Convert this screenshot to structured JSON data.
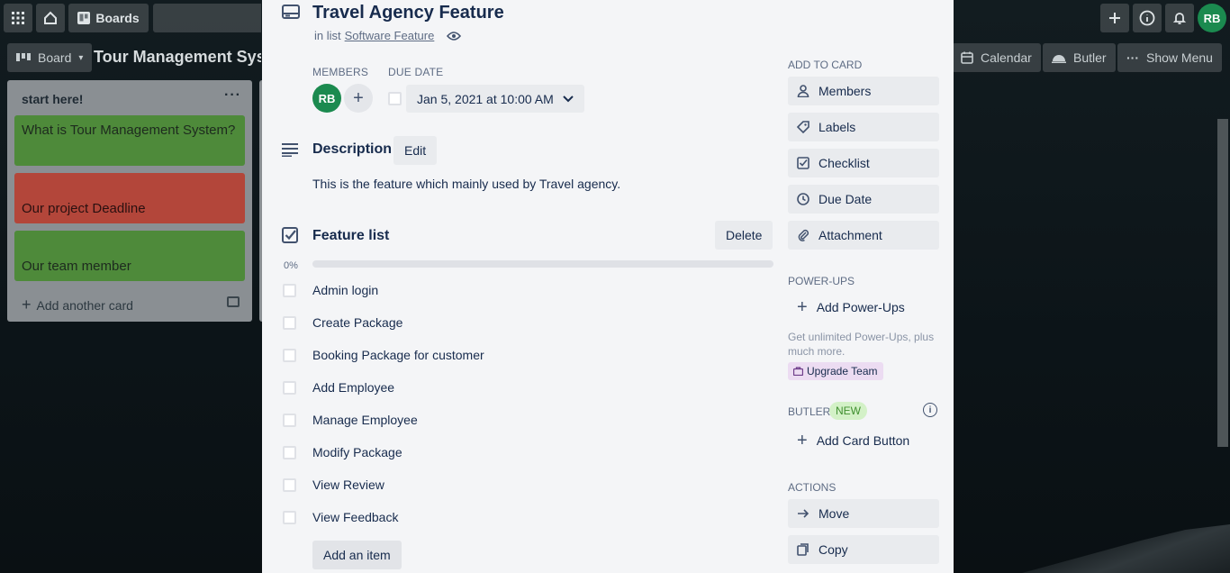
{
  "topbar": {
    "boards_label": "Boards",
    "user_initials": "RB"
  },
  "boardbar": {
    "board_view_label": "Board",
    "board_title": "Tour Management System",
    "calendar_label": "Calendar",
    "butler_label": "Butler",
    "show_menu_label": "Show Menu"
  },
  "list": {
    "title": "start here!",
    "menu": "···",
    "cards": [
      "What is Tour Management System?",
      "Our project Deadline",
      "Our team member"
    ],
    "add_card_label": "Add another card"
  },
  "card": {
    "title": "Travel Agency Feature",
    "in_list_prefix": "in list",
    "list_name": "Software Feature",
    "members_label": "MEMBERS",
    "member_initials": "RB",
    "add_member": "+",
    "due_date_label": "DUE DATE",
    "due_date_value": "Jan 5, 2021 at 10:00 AM",
    "description_title": "Description",
    "edit_label": "Edit",
    "description_text": "This is the feature which mainly used by Travel agency.",
    "checklist_title": "Feature list",
    "delete_label": "Delete",
    "progress_text": "0%",
    "progress_fraction": 0,
    "checklist_items": [
      "Admin login",
      "Create Package",
      "Booking Package for customer",
      "Add Employee",
      "Manage Employee",
      "Modify Package",
      "View Review",
      "View Feedback"
    ],
    "add_item_label": "Add an item"
  },
  "sidebar": {
    "add_to_card_head": "ADD TO CARD",
    "add_to_card": [
      "Members",
      "Labels",
      "Checklist",
      "Due Date",
      "Attachment"
    ],
    "powerups_head": "POWER-UPS",
    "add_powerups_label": "Add Power-Ups",
    "powerups_note": "Get unlimited Power-Ups, plus much more.",
    "upgrade_label": "Upgrade Team",
    "butler_head": "BUTLER",
    "new_badge": "NEW",
    "add_card_button_label": "Add Card Button",
    "actions_head": "ACTIONS",
    "move_label": "Move",
    "copy_label": "Copy"
  },
  "colors": {
    "avatar": "#1b8a4f",
    "progress": "#5ba4cf",
    "new_badge_bg": "#d3f1c7"
  }
}
